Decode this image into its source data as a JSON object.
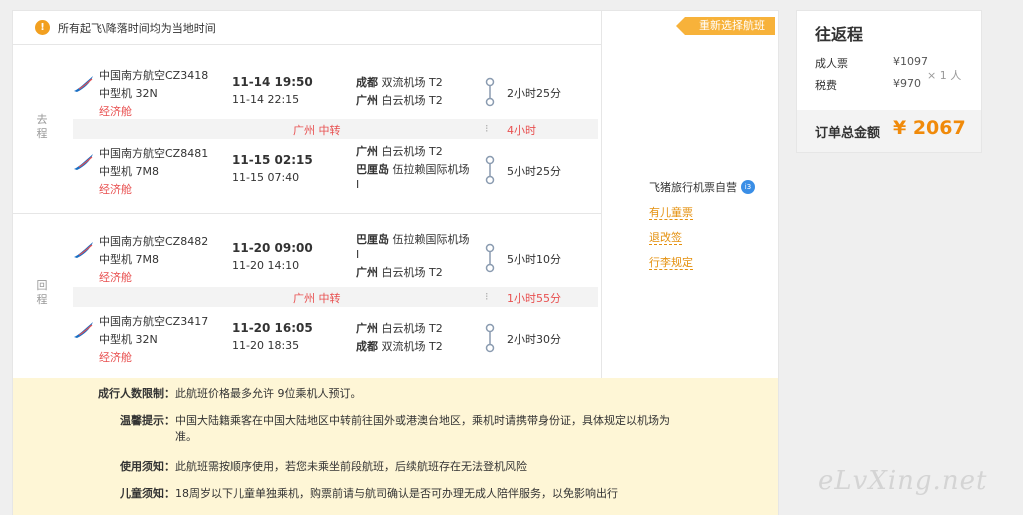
{
  "notice": "所有起飞\\降落时间均为当地时间",
  "reselect_label": "重新选择航班",
  "outbound_label": [
    "去",
    "程"
  ],
  "return_label": [
    "回",
    "程"
  ],
  "segments": [
    {
      "airline": "中国南方航空CZ3418",
      "plane": "中型机 32N",
      "cabin": "经济舱",
      "dep_time": "11-14 19:50",
      "arr_time": "11-14 22:15",
      "dep_city": "成都",
      "dep_airport": " 双流机场 T2",
      "arr_city": "广州",
      "arr_airport": " 白云机场 T2",
      "duration": "2小时25分"
    },
    {
      "airline": "中国南方航空CZ8481",
      "plane": "中型机 7M8",
      "cabin": "经济舱",
      "dep_time": "11-15 02:15",
      "arr_time": "11-15 07:40",
      "dep_city": "广州",
      "dep_airport": " 白云机场 T2",
      "arr_city": "巴厘岛",
      "arr_airport": " 伍拉赖国际机场 I",
      "duration": "5小时25分"
    },
    {
      "airline": "中国南方航空CZ8482",
      "plane": "中型机 7M8",
      "cabin": "经济舱",
      "dep_time": "11-20 09:00",
      "arr_time": "11-20 14:10",
      "dep_city": "巴厘岛",
      "dep_airport": " 伍拉赖国际机场 I",
      "arr_city": "广州",
      "arr_airport": " 白云机场 T2",
      "duration": "5小时10分"
    },
    {
      "airline": "中国南方航空CZ3417",
      "plane": "中型机 32N",
      "cabin": "经济舱",
      "dep_time": "11-20 16:05",
      "arr_time": "11-20 18:35",
      "dep_city": "广州",
      "dep_airport": " 白云机场 T2",
      "arr_city": "成都",
      "arr_airport": " 双流机场 T2",
      "duration": "2小时30分"
    }
  ],
  "transfers": [
    {
      "city": "广州 中转",
      "wait": "4小时"
    },
    {
      "city": "广州 中转",
      "wait": "1小时55分"
    }
  ],
  "self_operated": "飞猪旅行机票自营",
  "self_operated_badge": "i3",
  "policy_links": [
    "有儿童票",
    "退改签",
    "行李规定"
  ],
  "info": [
    {
      "label": "成行人数限制：",
      "text": "此航班价格最多允许 9位乘机人预订。"
    },
    {
      "label": "温馨提示：",
      "text": "中国大陆籍乘客在中国大陆地区中转前往国外或港澳台地区，乘机时请携带身份证，具体规定以机场为",
      "text2": "准。"
    },
    {
      "label": "使用须知：",
      "text": "此航班需按顺序使用，若您未乘坐前段航班，后续航班存在无法登机风险"
    },
    {
      "label": "儿童须知：",
      "text": "18周岁以下儿童单独乘机，购票前请与航司确认是否可办理无成人陪伴服务，以免影响出行"
    }
  ],
  "summary": {
    "title": "往返程",
    "adult_label": "成人票",
    "adult_price": "¥1097",
    "tax_label": "税费",
    "tax_price": "¥970",
    "qty": "× 1 人",
    "total_label": "订单总金额",
    "total_amount": "¥ 2067"
  },
  "watermark": "eLvXing.net",
  "colors": {
    "accent": "#f08a0a",
    "tag": "#f7b23a",
    "red": "#e85050",
    "airline_blue": "#1a6fc4",
    "info_bg": "#fef6d6"
  }
}
